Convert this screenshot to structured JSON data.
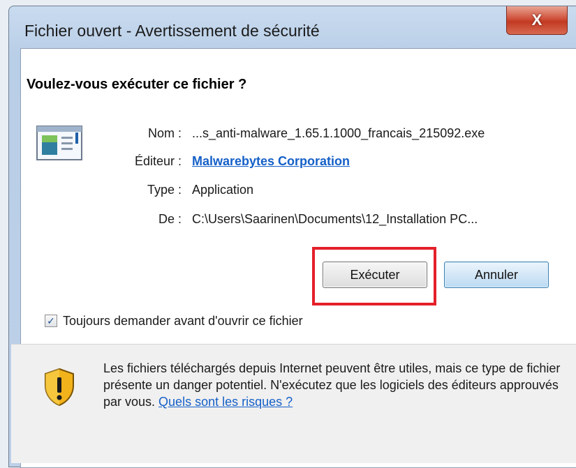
{
  "window": {
    "title": "Fichier ouvert - Avertissement de sécurité",
    "close_label": "X"
  },
  "heading": "Voulez-vous exécuter ce fichier ?",
  "file_info": {
    "name_label": "Nom :",
    "name_value": "...s_anti-malware_1.65.1.1000_francais_215092.exe",
    "publisher_label": "Éditeur :",
    "publisher_value": "Malwarebytes Corporation",
    "type_label": "Type :",
    "type_value": "Application",
    "from_label": "De :",
    "from_value": "C:\\Users\\Saarinen\\Documents\\12_Installation PC..."
  },
  "buttons": {
    "run_label": "Exécuter",
    "cancel_label": "Annuler"
  },
  "always_ask": {
    "checked": true,
    "label": "Toujours demander avant d'ouvrir ce fichier"
  },
  "warning": {
    "text": "Les fichiers téléchargés depuis Internet peuvent être utiles, mais ce type de fichier présente un danger potentiel. N'exécutez que les logiciels des éditeurs approuvés par vous. ",
    "link": "Quels sont les risques ?"
  },
  "icons": {
    "file": "application-file-icon",
    "shield": "security-warning-shield-icon"
  },
  "colors": {
    "highlight": "#e4202a",
    "link": "#1560c8",
    "close_button": "#c23a22"
  }
}
